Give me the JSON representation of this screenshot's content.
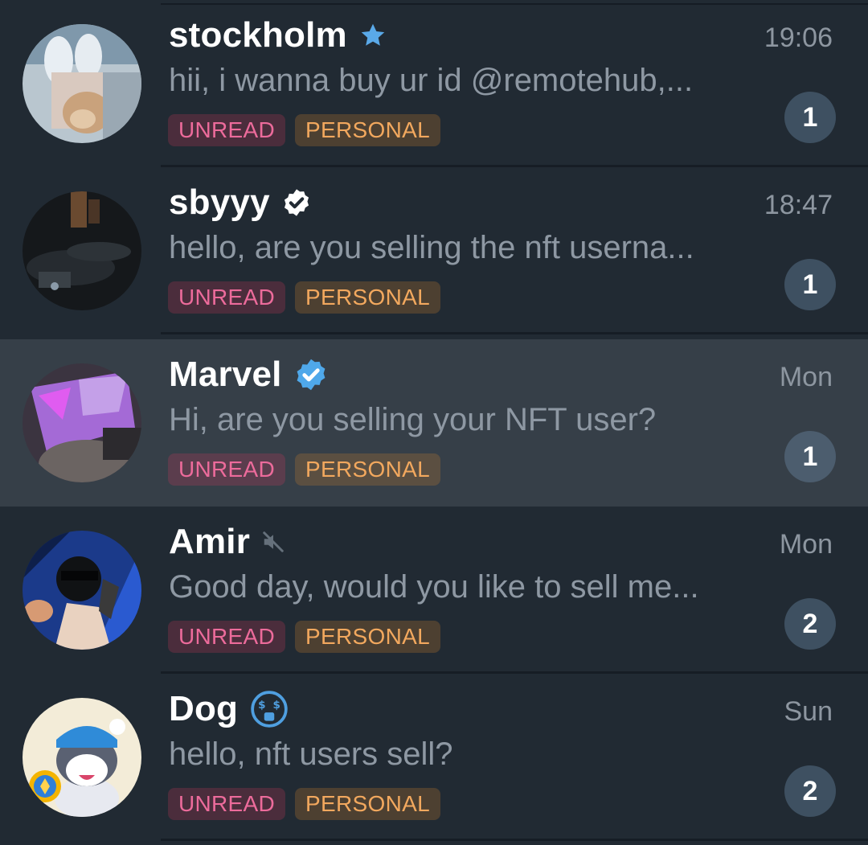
{
  "chats": [
    {
      "name": "stockholm",
      "name_icon": "star-icon",
      "time": "19:06",
      "preview": "hii, i wanna buy ur id @remotehub,...",
      "tags": [
        "UNREAD",
        "PERSONAL"
      ],
      "unread_count": "1",
      "selected": false
    },
    {
      "name": "sbyyy",
      "name_icon": "verified-check-icon",
      "time": "18:47",
      "preview": "hello, are you selling the nft userna...",
      "tags": [
        "UNREAD",
        "PERSONAL"
      ],
      "unread_count": "1",
      "selected": false
    },
    {
      "name": "Marvel",
      "name_icon": "verified-badge-icon",
      "time": "Mon",
      "preview": "Hi, are you selling your NFT user?",
      "tags": [
        "UNREAD",
        "PERSONAL"
      ],
      "unread_count": "1",
      "selected": true
    },
    {
      "name": "Amir",
      "name_icon": "muted-speaker-icon",
      "time": "Mon",
      "preview": "Good day, would you like to sell me...",
      "tags": [
        "UNREAD",
        "PERSONAL"
      ],
      "unread_count": "2",
      "selected": false
    },
    {
      "name": "Dog",
      "name_icon": "money-face-emoji-icon",
      "time": "Sun",
      "preview": "hello, nft users sell?",
      "tags": [
        "UNREAD",
        "PERSONAL"
      ],
      "unread_count": "2",
      "selected": false
    }
  ],
  "colors": {
    "background": "#212a33",
    "selected_row": "#363f48",
    "unread_tag": "#ec6b9b",
    "personal_tag": "#f2a85e",
    "badge": "#3e5061",
    "verified_blue": "#4fa8ea"
  }
}
